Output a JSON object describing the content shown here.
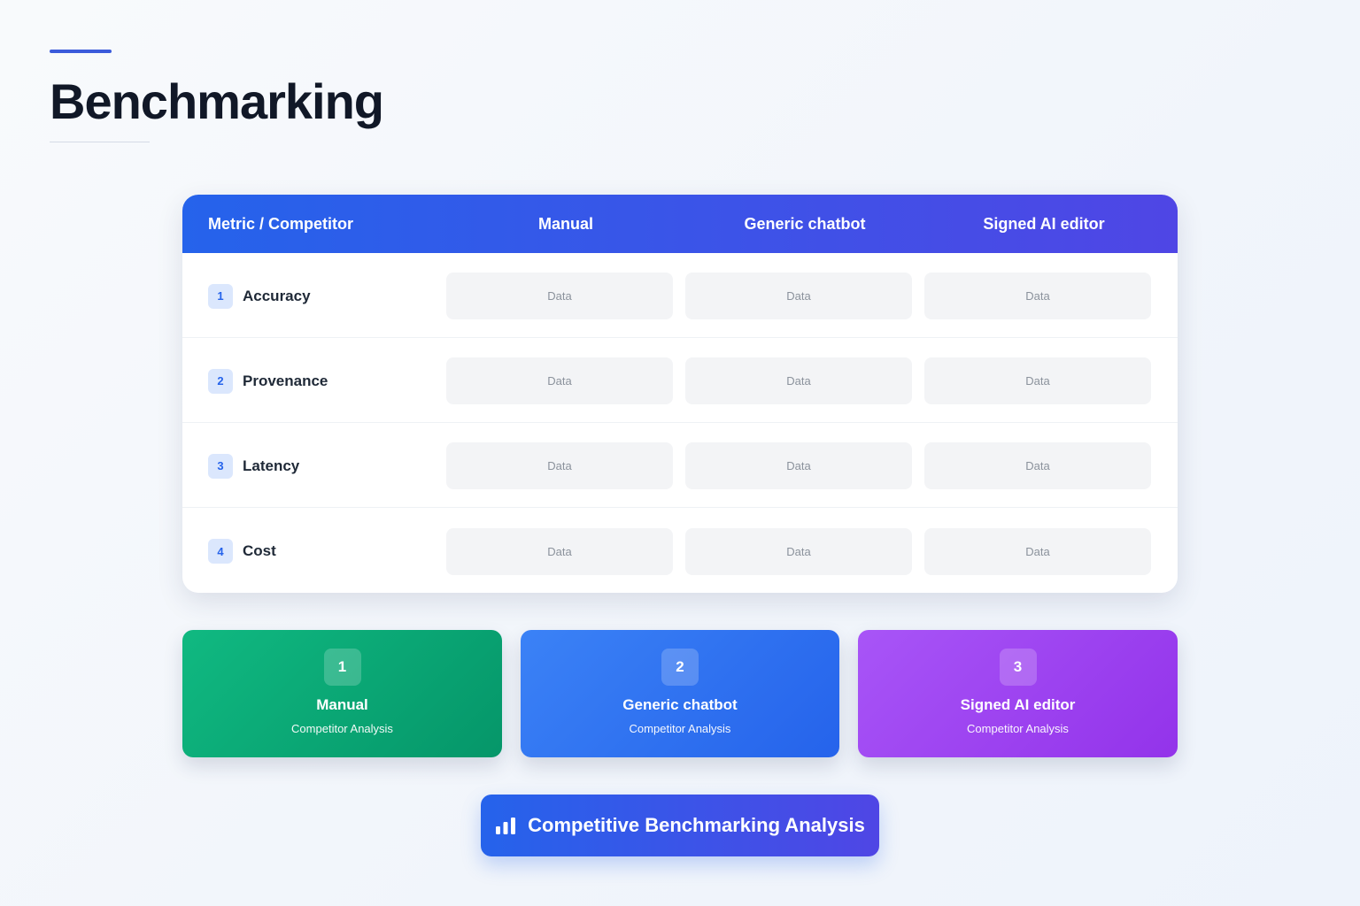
{
  "page": {
    "title": "Benchmarking"
  },
  "table": {
    "headers": {
      "metric": "Metric / Competitor",
      "columns": [
        "Manual",
        "Generic chatbot",
        "Signed AI editor"
      ]
    },
    "rows": [
      {
        "num": "1",
        "label": "Accuracy",
        "cells": [
          "Data",
          "Data",
          "Data"
        ]
      },
      {
        "num": "2",
        "label": "Provenance",
        "cells": [
          "Data",
          "Data",
          "Data"
        ]
      },
      {
        "num": "3",
        "label": "Latency",
        "cells": [
          "Data",
          "Data",
          "Data"
        ]
      },
      {
        "num": "4",
        "label": "Cost",
        "cells": [
          "Data",
          "Data",
          "Data"
        ]
      }
    ]
  },
  "competitors": [
    {
      "num": "1",
      "name": "Manual",
      "subtitle": "Competitor Analysis",
      "color": "#10b981"
    },
    {
      "num": "2",
      "name": "Generic chatbot",
      "subtitle": "Competitor Analysis",
      "color": "#3b82f6"
    },
    {
      "num": "3",
      "name": "Signed AI editor",
      "subtitle": "Competitor Analysis",
      "color": "#a855f7"
    }
  ],
  "banner": {
    "label": "Competitive Benchmarking Analysis",
    "icon": "bar-chart-icon"
  },
  "colors": {
    "accent": "#2563eb",
    "accent_end": "#4f46e5"
  }
}
